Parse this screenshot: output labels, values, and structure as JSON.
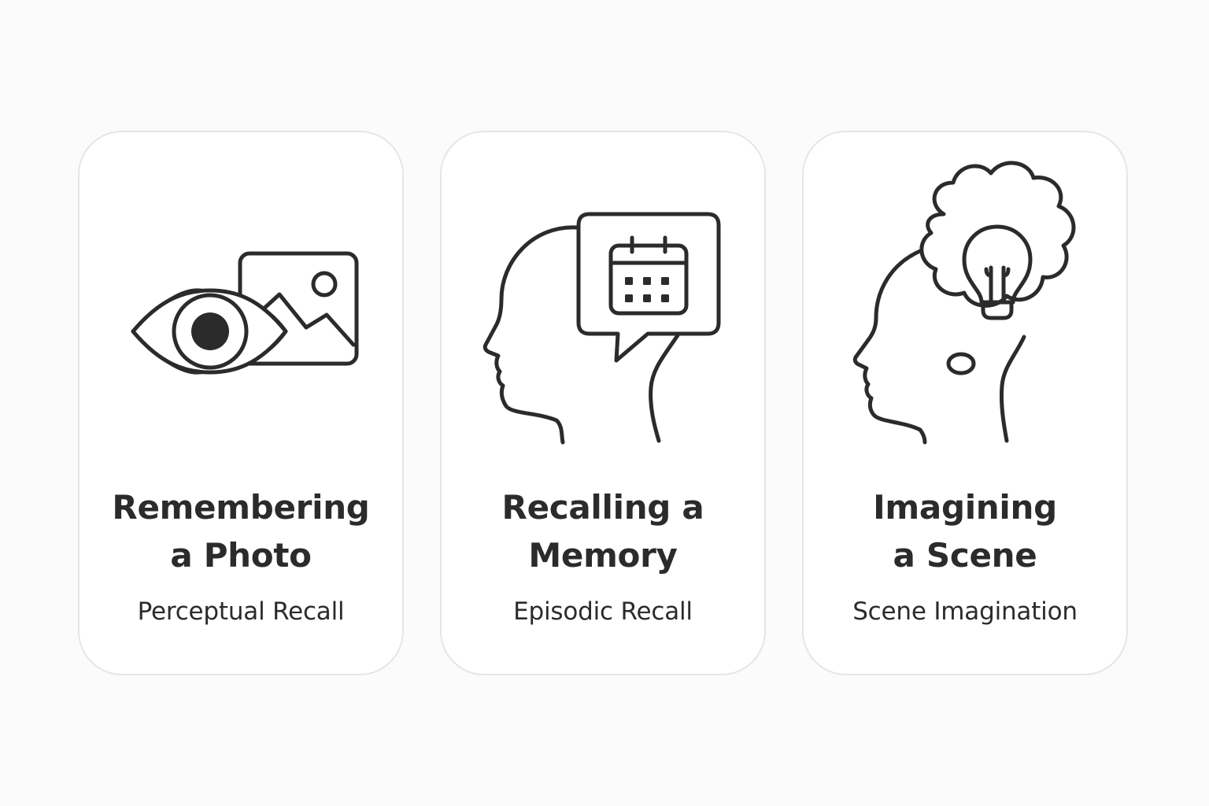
{
  "cards": [
    {
      "title": "Remembering\na Photo",
      "subtitle": "Perceptual Recall",
      "icon": "eye-with-photo-icon"
    },
    {
      "title": "Recalling a\nMemory",
      "subtitle": "Episodic Recall",
      "icon": "head-with-calendar-bubble-icon"
    },
    {
      "title": "Imagining\na Scene",
      "subtitle": "Scene Imagination",
      "icon": "head-with-lightbulb-thought-icon"
    }
  ],
  "colors": {
    "background": "#fbfbfb",
    "card": "#ffffff",
    "card_border": "#e6e6e6",
    "ink": "#2b2b2b"
  }
}
